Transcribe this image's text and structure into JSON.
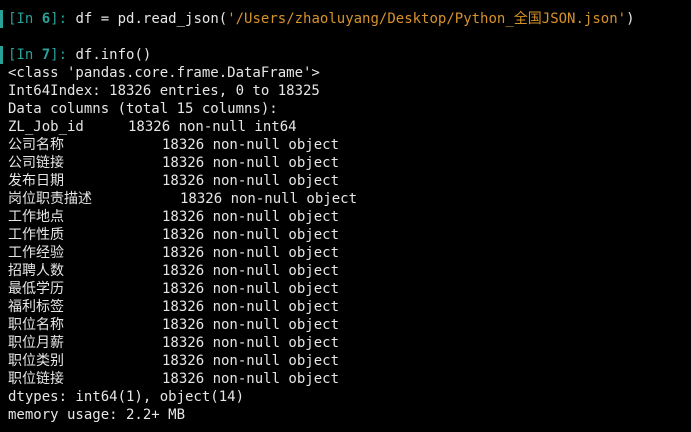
{
  "colors": {
    "background": "#000000",
    "prompt": "#2aa198",
    "string": "#d6922b",
    "text": "#e6e6e6"
  },
  "cell6": {
    "prompt_open": "[",
    "prompt_in": "In ",
    "prompt_num": "6",
    "prompt_close": "]:",
    "code_before": " df = pd.read_json(",
    "string": "'/Users/zhaoluyang/Desktop/Python_全国JSON.json'",
    "code_after": ")"
  },
  "cell7": {
    "prompt_open": "[",
    "prompt_in": "In ",
    "prompt_num": "7",
    "prompt_close": "]:",
    "code": " df.info()"
  },
  "output": {
    "class_line": "<class 'pandas.core.frame.DataFrame'>",
    "index_line": "Int64Index: 18326 entries, 0 to 18325",
    "columns_header": "Data columns (total 15 columns):",
    "columns": [
      {
        "name": "ZL_Job_id",
        "info": "18326 non-null int64"
      },
      {
        "name": "公司名称",
        "info": "18326 non-null object"
      },
      {
        "name": "公司链接",
        "info": "18326 non-null object"
      },
      {
        "name": "发布日期",
        "info": "18326 non-null object"
      },
      {
        "name": "岗位职责描述",
        "info": "18326 non-null object"
      },
      {
        "name": "工作地点",
        "info": "18326 non-null object"
      },
      {
        "name": "工作性质",
        "info": "18326 non-null object"
      },
      {
        "name": "工作经验",
        "info": "18326 non-null object"
      },
      {
        "name": "招聘人数",
        "info": "18326 non-null object"
      },
      {
        "name": "最低学历",
        "info": "18326 non-null object"
      },
      {
        "name": "福利标签",
        "info": "18326 non-null object"
      },
      {
        "name": "职位名称",
        "info": "18326 non-null object"
      },
      {
        "name": "职位月薪",
        "info": "18326 non-null object"
      },
      {
        "name": "职位类别",
        "info": "18326 non-null object"
      },
      {
        "name": "职位链接",
        "info": "18326 non-null object"
      }
    ],
    "dtypes_line": "dtypes: int64(1), object(14)",
    "memory_line": "memory usage: 2.2+ MB"
  }
}
